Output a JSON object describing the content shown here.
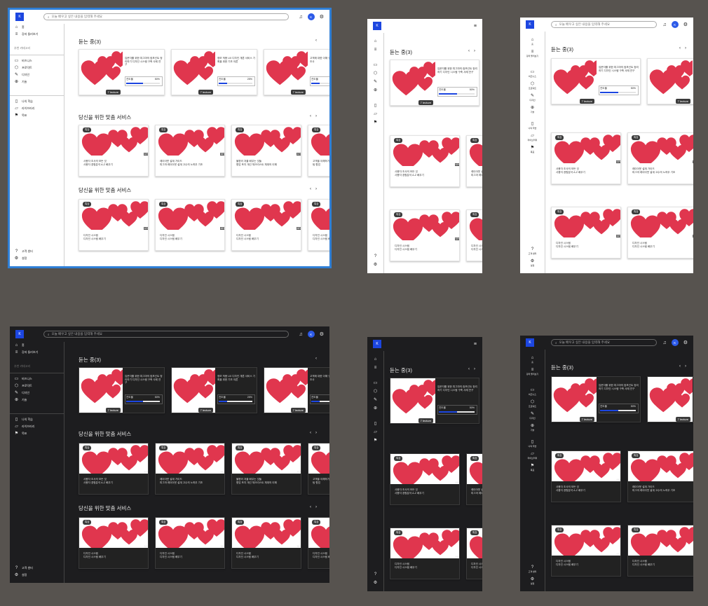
{
  "header": {
    "logo": "K",
    "search_placeholder": "오늘 배우고 싶은 내용을 입력해 주세요",
    "avatar_letter": "K"
  },
  "sidebar": {
    "home": "홈",
    "browse": "강좌 둘러보기",
    "category_heading": "추천 카테고리",
    "categories": [
      "비즈니스",
      "프로덕트",
      "디자인",
      "기술"
    ],
    "my_learning": "나의 학습",
    "library": "라이브러리",
    "goals": "목표",
    "help": "고객 센터",
    "settings": "설정"
  },
  "sections": {
    "listening": {
      "title": "듣는 중(3)"
    },
    "recommended_1": {
      "title": "당신을 위한 맞춤 서비스"
    },
    "recommended_2": {
      "title": "당신을 위한 맞춤 서비스"
    }
  },
  "listening": [
    {
      "title": "입문자를 위한 피그마의 컴포넌트 정리하기",
      "subtitle": "디자인 시스템 구축 사례 연구",
      "length": "7 lecture",
      "progress_label": "진도율",
      "progress": "50%",
      "fraction": 0.5
    },
    {
      "title": "정보 적용 UX 디자인 개론",
      "subtitle": "서비스 기획을 위한 기초 이론",
      "length": "7 lecture",
      "progress_label": "진도율",
      "progress": "25%",
      "fraction": 0.25
    },
    {
      "title": "고객에 대한 이해 구축하기",
      "subtitle": "사용자 조사",
      "length": "7 lecture",
      "progress_label": "진도율",
      "progress": "25%",
      "fraction": 0.25
    }
  ],
  "recommended_1": [
    {
      "badge": "특강",
      "percent": "64%",
      "line1": "사용자 조사의 모든 것",
      "line2": "사용자 경험분석 A-Z 배우기"
    },
    {
      "badge": "특강",
      "percent": "58%",
      "line1": "레이아웃 설계 가이드",
      "line2": "피그마 레이아웃 설계 고수의 노하우 기초"
    },
    {
      "badge": "특강",
      "percent": "40%",
      "line1": "불편러 겨울 배우는 것들",
      "line2": "협업 포지 개선 체크리스트 체계의 이해"
    },
    {
      "badge": "특강",
      "percent": "30%",
      "line1": "고객을 이해하기",
      "line2": "팀 협업"
    }
  ],
  "recommended_2": [
    {
      "badge": "특강",
      "percent": "64%",
      "line1": "디자인 시스템",
      "line2": "디자인 시스템 배우기"
    },
    {
      "badge": "특강",
      "percent": "68%",
      "line1": "디자인 시스템",
      "line2": "디자인 시스템 배우기"
    },
    {
      "badge": "특강",
      "percent": "68%",
      "line1": "디자인 시스템",
      "line2": "디자인 시스템 배우기"
    },
    {
      "badge": "특강",
      "percent": "68%",
      "line1": "디자인 시스템",
      "line2": "디자인 시스템 배우기"
    }
  ],
  "colors": {
    "brand": "#1c46e0",
    "heart": "#e0364e",
    "light_bg": "#ffffff",
    "dark_bg": "#1d1d1f",
    "selection": "#2f7fd6"
  },
  "icons": {
    "theme": "sun-icon",
    "notifications": "bell-icon",
    "settings": "gear-icon",
    "menu": "hamburger-icon"
  }
}
